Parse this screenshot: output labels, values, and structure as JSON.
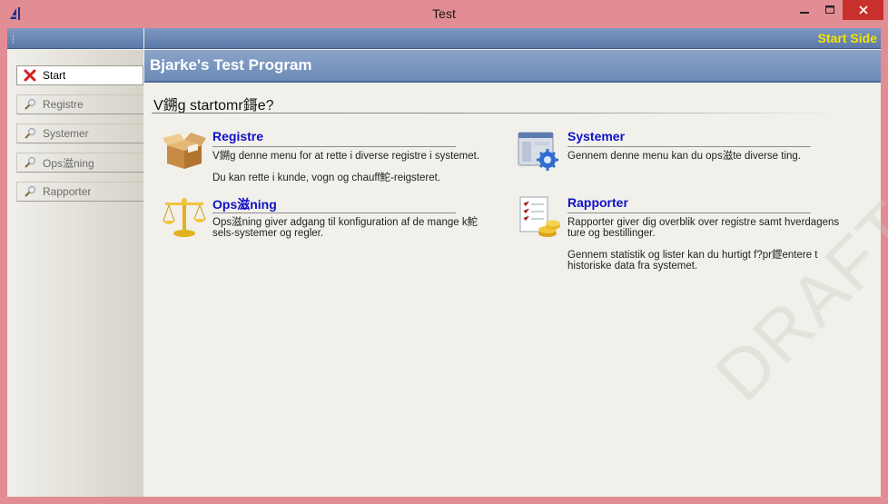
{
  "window": {
    "title": "Test"
  },
  "topbar": {
    "start_side": "Start Side"
  },
  "sidebar": {
    "items": [
      {
        "label": "Start",
        "icon": "close-x-icon"
      },
      {
        "label": "Registre",
        "icon": "magnifier-icon"
      },
      {
        "label": "Systemer",
        "icon": "magnifier-icon"
      },
      {
        "label": "Ops滋ning",
        "icon": "magnifier-icon"
      },
      {
        "label": "Rapporter",
        "icon": "magnifier-icon"
      }
    ]
  },
  "main": {
    "program_title": "Bjarke's Test Program",
    "question": "V鎙g startomr鎶e?",
    "tiles": [
      {
        "title": "Registre",
        "icon": "box-icon",
        "desc": [
          "V鎙g denne menu for at rette i diverse registre i systemet.",
          "Du kan rette i kunde, vogn og chauff鮀-reigsteret."
        ]
      },
      {
        "title": "Systemer",
        "icon": "system-gear-icon",
        "desc": [
          "Gennem denne menu kan du ops滋te diverse ting."
        ]
      },
      {
        "title": "Ops滋ning",
        "icon": "scales-icon",
        "desc": [
          "Ops滋ning giver adgang til konfiguration af de mange k鮀sels-systemer og regler."
        ]
      },
      {
        "title": "Rapporter",
        "icon": "report-coins-icon",
        "desc": [
          "Rapporter giver dig overblik over registre samt hverdagens ture og bestillinger.",
          "Gennem statistik og lister kan du hurtigt f?pr鎠entere t historiske data fra systemet."
        ]
      }
    ]
  },
  "watermark": "DRAFT",
  "colors": {
    "accent_blue": "#6d8bb8",
    "link_blue": "#1010c8",
    "start_side_yellow": "#f5e400",
    "close_red": "#c9302c"
  }
}
